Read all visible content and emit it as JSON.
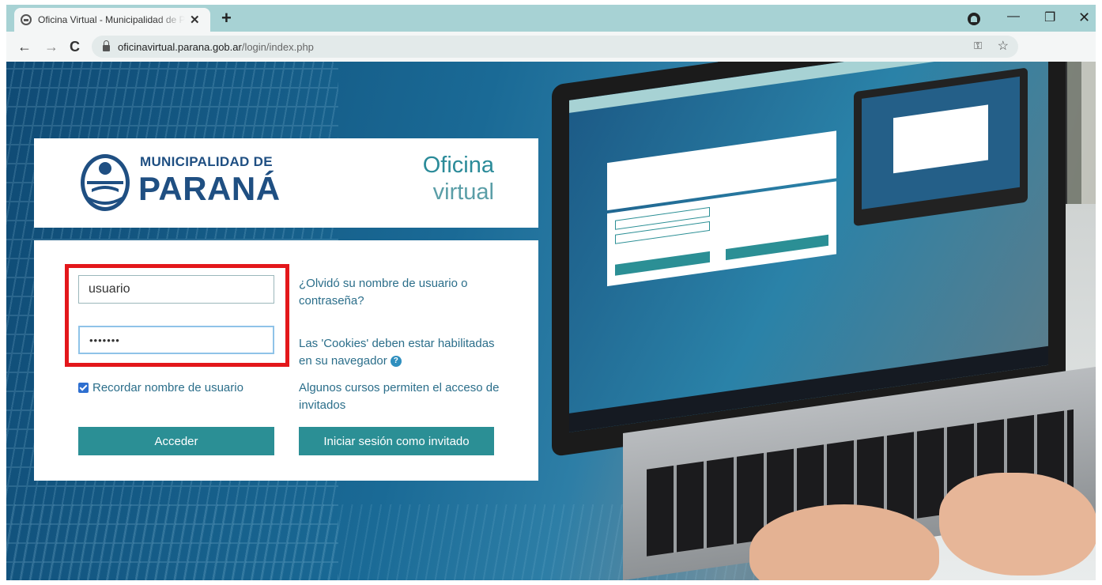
{
  "browser": {
    "tab_title": "Oficina Virtual - Municipalidad de Paraná",
    "tab_close": "✕",
    "new_tab": "+",
    "url_host": "oficinavirtual.parana.gob.ar",
    "url_path": "/login/index.php",
    "controls": {
      "minimize": "—",
      "maximize": "❐",
      "close": "✕",
      "back": "←",
      "forward": "→",
      "reload": "C"
    }
  },
  "header": {
    "brand_top": "MUNICIPALIDAD DE",
    "brand_main": "PARANÁ",
    "oficina": "Oficina",
    "virtual": "virtual"
  },
  "login": {
    "username_value": "usuario",
    "password_value": "•••••••",
    "remember_label": "Recordar nombre de usuario",
    "remember_checked": true,
    "login_button": "Acceder",
    "forgot_link": "¿Olvidó su nombre de usuario o contraseña?",
    "cookies_info": "Las 'Cookies' deben estar habilitadas en su navegador",
    "help_icon": "?",
    "guests_info": "Algunos cursos permiten el acceso de invitados",
    "guest_button": "Iniciar sesión como invitado"
  },
  "colors": {
    "brand_blue": "#1f4f82",
    "teal": "#2b8f95",
    "highlight_red": "#e3171b",
    "chrome_tab": "#a7d2d4"
  },
  "icons": [
    "site-favicon-icon",
    "lock-icon",
    "key-icon",
    "star-icon",
    "profile-icon",
    "help-icon",
    "municipality-seal-icon"
  ]
}
